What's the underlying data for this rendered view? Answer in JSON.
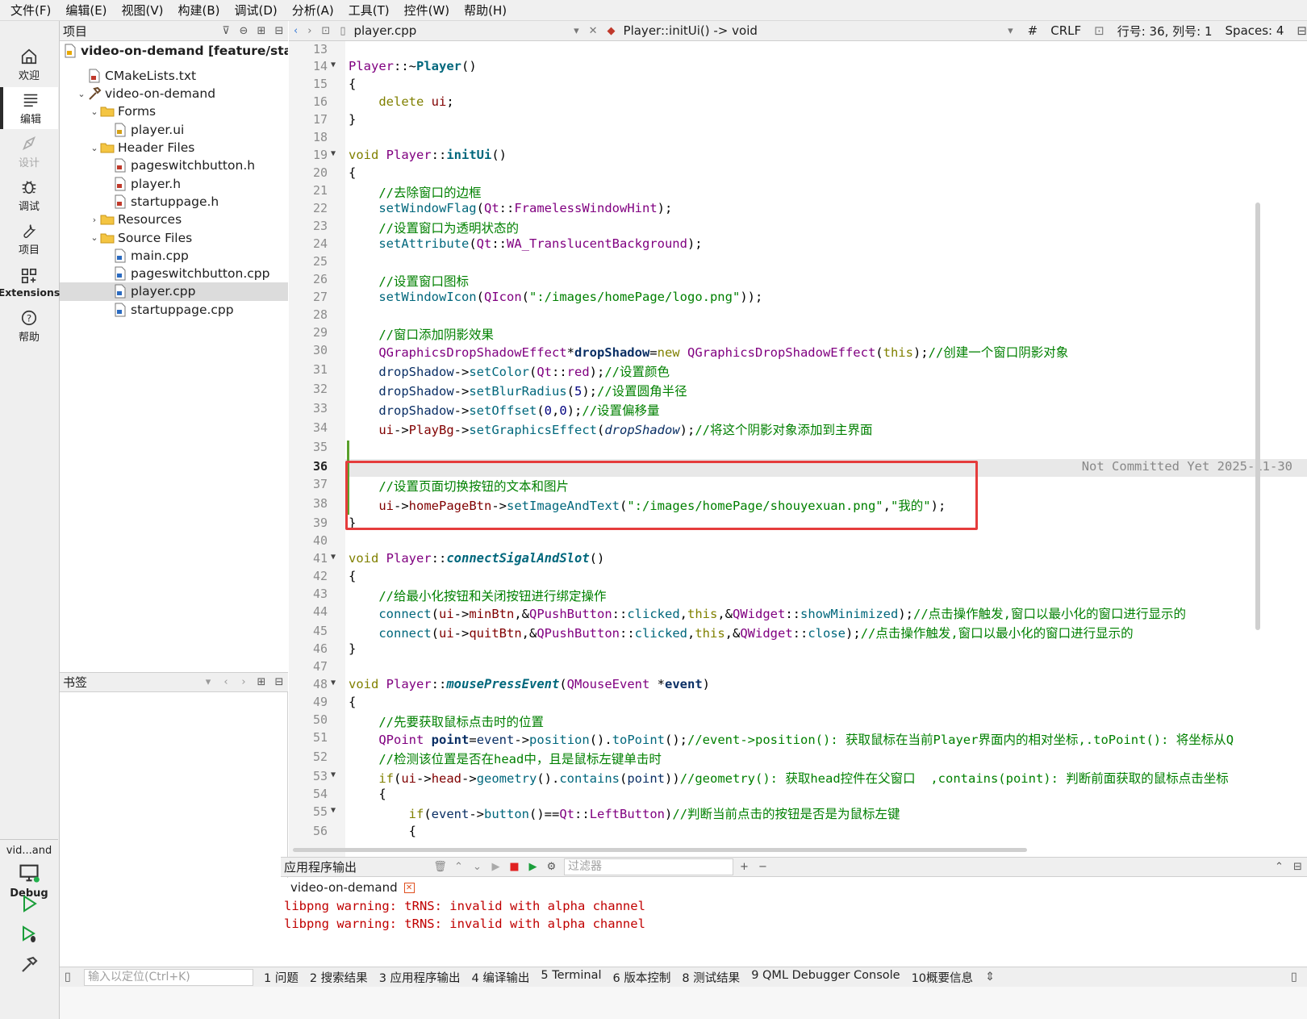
{
  "menu": [
    "文件(F)",
    "编辑(E)",
    "视图(V)",
    "构建(B)",
    "调试(D)",
    "分析(A)",
    "工具(T)",
    "控件(W)",
    "帮助(H)"
  ],
  "modes": [
    {
      "label": "欢迎",
      "icon": "home-icon"
    },
    {
      "label": "编辑",
      "icon": "edit-icon"
    },
    {
      "label": "设计",
      "icon": "design-icon"
    },
    {
      "label": "调试",
      "icon": "debug-bug-icon"
    },
    {
      "label": "项目",
      "icon": "wrench-icon"
    },
    {
      "label": "Extensions",
      "icon": "extensions-icon"
    },
    {
      "label": "帮助",
      "icon": "help-icon"
    }
  ],
  "kit": {
    "name": "vid...and",
    "config": "Debug"
  },
  "project": {
    "title": "项目",
    "tree": [
      {
        "label": "video-on-demand [feature/startui",
        "depth": 0,
        "arrow": "",
        "icon": "project-root-icon",
        "bold": true
      },
      {
        "label": "CMakeLists.txt",
        "depth": 1,
        "arrow": "",
        "icon": "cmake-file-icon"
      },
      {
        "label": "video-on-demand",
        "depth": 1,
        "arrow": "open",
        "icon": "hammer-icon"
      },
      {
        "label": "Forms",
        "depth": 2,
        "arrow": "open",
        "icon": "folder-forms-icon"
      },
      {
        "label": "player.ui",
        "depth": 3,
        "arrow": "",
        "icon": "ui-file-icon"
      },
      {
        "label": "Header Files",
        "depth": 2,
        "arrow": "open",
        "icon": "folder-header-icon"
      },
      {
        "label": "pageswitchbutton.h",
        "depth": 3,
        "arrow": "",
        "icon": "header-file-icon"
      },
      {
        "label": "player.h",
        "depth": 3,
        "arrow": "",
        "icon": "header-file-icon"
      },
      {
        "label": "startuppage.h",
        "depth": 3,
        "arrow": "",
        "icon": "header-file-icon"
      },
      {
        "label": "Resources",
        "depth": 2,
        "arrow": "closed",
        "icon": "folder-resources-icon"
      },
      {
        "label": "Source Files",
        "depth": 2,
        "arrow": "open",
        "icon": "folder-source-icon"
      },
      {
        "label": "main.cpp",
        "depth": 3,
        "arrow": "",
        "icon": "cpp-file-icon"
      },
      {
        "label": "pageswitchbutton.cpp",
        "depth": 3,
        "arrow": "",
        "icon": "cpp-file-icon"
      },
      {
        "label": "player.cpp",
        "depth": 3,
        "arrow": "",
        "icon": "cpp-file-icon",
        "selected": true
      },
      {
        "label": "startuppage.cpp",
        "depth": 3,
        "arrow": "",
        "icon": "cpp-file-icon"
      }
    ]
  },
  "bookmarks": {
    "title": "书签"
  },
  "editor_toolbar": {
    "file": "player.cpp",
    "function": "Player::initUi() -> void",
    "hash": "#",
    "line_ending": "CRLF",
    "position": "行号: 36, 列号: 1",
    "indent": "Spaces: 4"
  },
  "editor": {
    "current_line": 36,
    "blame": "Not Committed Yet 2025-11-30",
    "line_numbers": [
      "13",
      "14",
      "15",
      "16",
      "17",
      "18",
      "19",
      "20",
      "21",
      "22",
      "23",
      "24",
      "25",
      "26",
      "27",
      "28",
      "29",
      "30",
      "31",
      "32",
      "33",
      "34",
      "35",
      "36",
      "37",
      "38",
      "39",
      "40",
      "41",
      "42",
      "43",
      "44",
      "45",
      "46",
      "47",
      "48",
      "49",
      "50",
      "51",
      "52",
      "53",
      "54",
      "55",
      "56"
    ]
  },
  "output": {
    "title": "应用程序输出",
    "filter_placeholder": "过滤器",
    "tab": "video-on-demand",
    "lines": [
      "libpng warning: tRNS: invalid with alpha channel",
      "libpng warning: tRNS: invalid with alpha channel"
    ]
  },
  "status": {
    "locator_placeholder": "输入以定位(Ctrl+K)",
    "tabs": [
      "1 问题",
      "2 搜索结果",
      "3 应用程序输出",
      "4 编译输出",
      "5 Terminal",
      "6 版本控制",
      "8 测试结果",
      "9 QML Debugger Console",
      "10概要信息"
    ]
  },
  "colors": {
    "highlight_box": "#e53c3c",
    "keyword": "#808000",
    "comment": "#008000",
    "type": "#800080",
    "function": "#00677c",
    "output_text": "#c00000"
  }
}
